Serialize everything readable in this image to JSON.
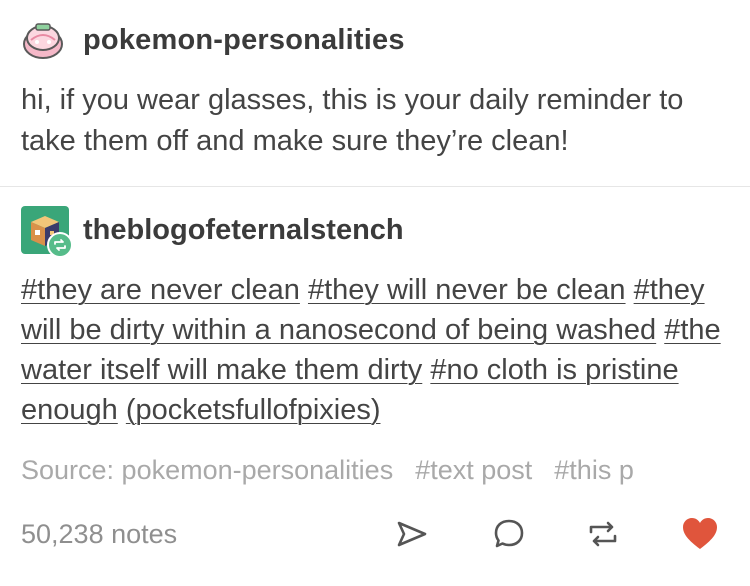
{
  "original_post": {
    "username": "pokemon-personalities",
    "avatar_icon": "pink-pokeball-icon",
    "body": "hi, if you wear glasses, this is your daily reminder to take them off and make sure they’re clean!"
  },
  "reblog": {
    "username": "theblogofeternalstench",
    "avatar_icon": "pixel-cube-icon",
    "badge_icon": "reblog-icon",
    "tags": [
      "#they are never clean",
      "#they will never be clean",
      "#they will be dirty within a nanosecond of being washed",
      "#the water itself will make them dirty",
      "#no cloth is pristine enough",
      "(pocketsfullofpixies)"
    ]
  },
  "footer": {
    "source": "Source: pokemon-personalities",
    "post_tags": [
      "#text post",
      "#this p"
    ],
    "notes": "50,238 notes"
  },
  "actions": {
    "share_icon": "share-icon",
    "reply_icon": "reply-icon",
    "reblog_icon": "reblog-icon",
    "like_icon": "heart-icon"
  },
  "colors": {
    "text": "#444444",
    "muted": "#a9a9a9",
    "heart": "#e0553c",
    "reblog_badge": "#56bc8a"
  }
}
